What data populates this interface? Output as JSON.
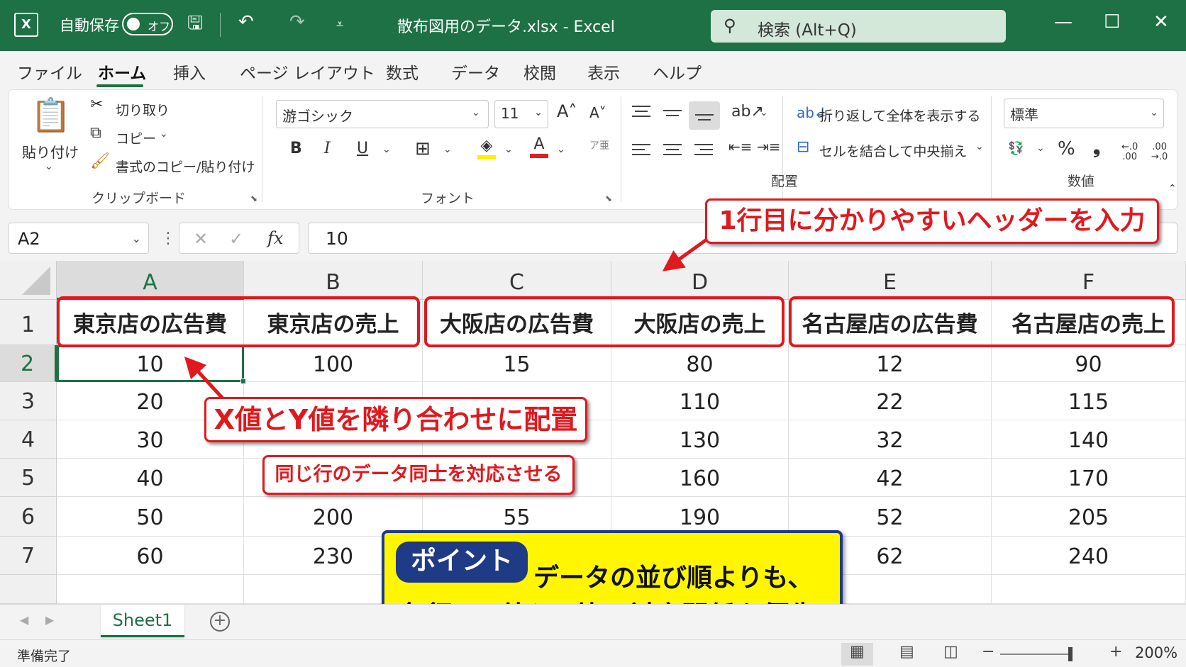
{
  "titlebar": {
    "logo": "X",
    "autosave_label": "自動保存",
    "autosave_state": "オフ",
    "document_title": "散布図用のデータ.xlsx  -  Excel",
    "search_placeholder": "検索 (Alt+Q)"
  },
  "menu": [
    "ファイル",
    "ホーム",
    "挿入",
    "ページ レイアウト",
    "数式",
    "データ",
    "校閲",
    "表示",
    "ヘルプ"
  ],
  "ribbon": {
    "clipboard": {
      "paste": "貼り付け",
      "cut": "切り取り",
      "copy": "コピー",
      "format_painter": "書式のコピー/貼り付け",
      "label": "クリップボード"
    },
    "font": {
      "font_name": "游ゴシック",
      "font_size": "11",
      "label": "フォント"
    },
    "alignment": {
      "wrap_text": "折り返して全体を表示する",
      "merge_center": "セルを結合して中央揃え",
      "label": "配置"
    },
    "number": {
      "format": "標準",
      "label": "数値"
    }
  },
  "formula_bar": {
    "name_box": "A2",
    "fx": "fx",
    "value": "10"
  },
  "sheet": {
    "columns": [
      "A",
      "B",
      "C",
      "D",
      "E",
      "F"
    ],
    "row_numbers": [
      "1",
      "2",
      "3",
      "4",
      "5",
      "6",
      "7"
    ],
    "headers": [
      "東京店の広告費",
      "東京店の売上",
      "大阪店の広告費",
      "大阪店の売上",
      "名古屋店の広告費",
      "名古屋店の売上"
    ],
    "rows": [
      [
        "10",
        "100",
        "15",
        "80",
        "12",
        "90"
      ],
      [
        "20",
        "",
        "",
        "110",
        "22",
        "115"
      ],
      [
        "30",
        "",
        "",
        "130",
        "32",
        "140"
      ],
      [
        "40",
        "",
        "",
        "160",
        "42",
        "170"
      ],
      [
        "50",
        "200",
        "55",
        "190",
        "52",
        "205"
      ],
      [
        "60",
        "230",
        "",
        "",
        "62",
        "240"
      ]
    ]
  },
  "sheet_tab": "Sheet1",
  "status": {
    "ready": "準備完了",
    "zoom": "200%"
  },
  "annotations": {
    "header_callout": "1行目に分かりやすいヘッダーを入力",
    "pair_callout": "X値とY値を隣り合わせに配置",
    "row_callout": "同じ行のデータ同士を対応させる",
    "point_badge": "ポイント",
    "point_line1": "データの並び順よりも、",
    "point_line2": "各行のX値とY値の対応関係を優先"
  },
  "colors": {
    "excel_green": "#1e7145",
    "annotation_red": "#e0191e",
    "point_yellow": "#fff600",
    "point_navy": "#1f3b85"
  }
}
